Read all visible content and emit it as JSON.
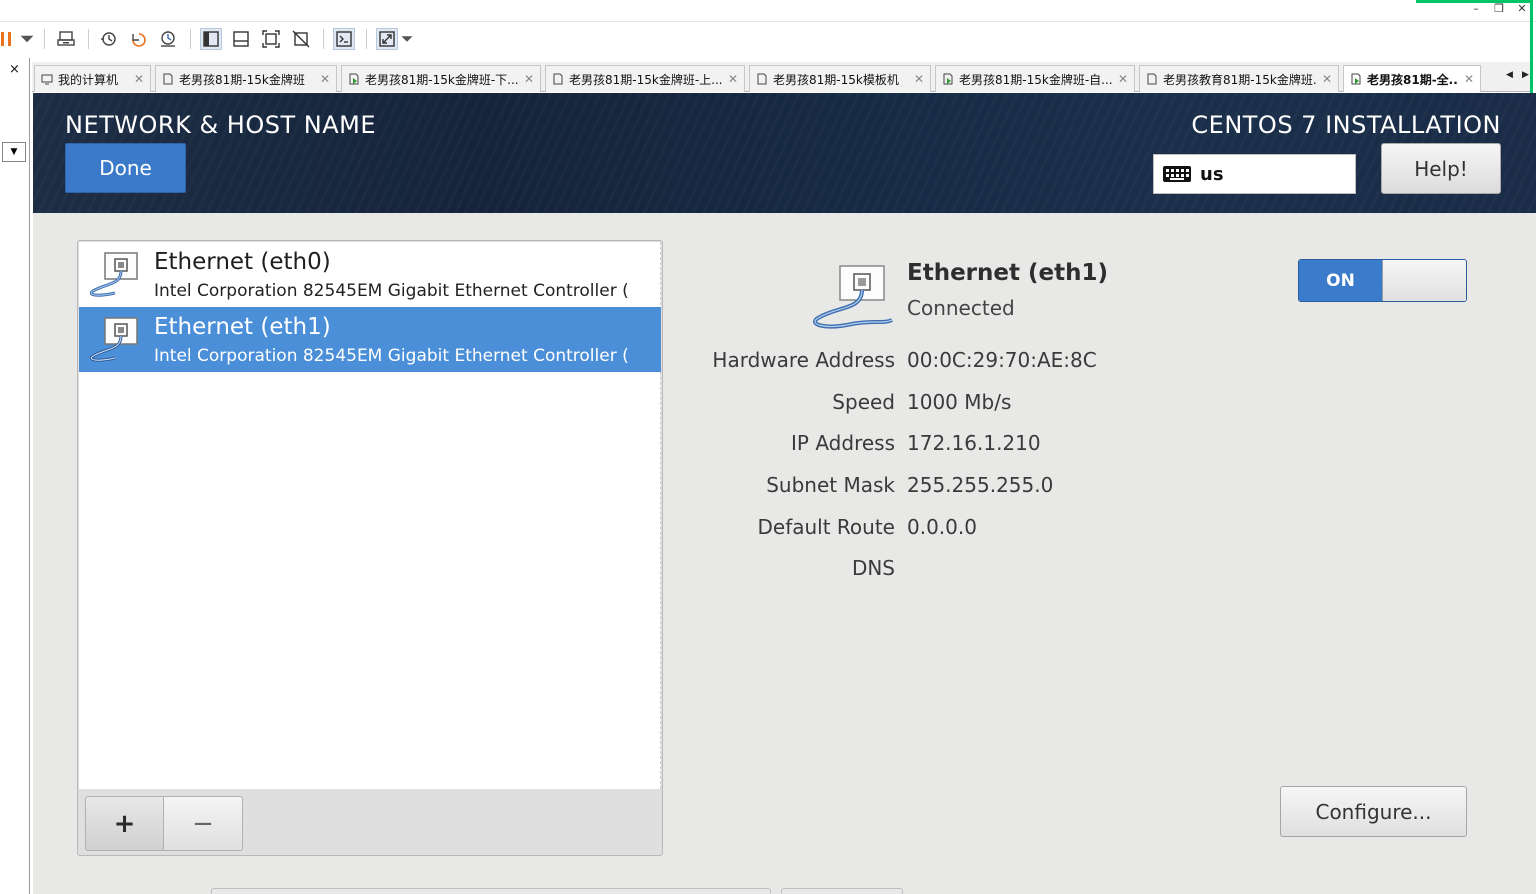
{
  "window": {
    "minimize_glyph": "–",
    "restore_glyph": "❐",
    "close_glyph": "✕"
  },
  "toolbar": {
    "icons": [
      "pause-icon",
      "dropdown-icon",
      "send-ctrl-alt-del-icon",
      "snapshot-icon",
      "revert-snapshot-icon",
      "snapshot-manager-icon",
      "sidebar-view-icon",
      "console-view-icon",
      "fullscreen-icon",
      "unity-icon",
      "terminal-icon",
      "stretch-icon"
    ]
  },
  "sidebar": {
    "close_glyph": "×",
    "dropdown_glyph": "▼"
  },
  "tabs": [
    {
      "label": "我的计算机",
      "icon": "computer-icon",
      "active": false
    },
    {
      "label": "老男孩81期-15k金牌班",
      "icon": "vm-icon",
      "active": false
    },
    {
      "label": "老男孩81期-15k金牌班-下...",
      "icon": "vm-running-icon",
      "active": false
    },
    {
      "label": "老男孩81期-15k金牌班-上...",
      "icon": "vm-icon",
      "active": false
    },
    {
      "label": "老男孩81期-15k模板机",
      "icon": "vm-icon",
      "active": false
    },
    {
      "label": "老男孩81期-15k金牌班-自...",
      "icon": "vm-running-icon",
      "active": false
    },
    {
      "label": "老男孩教育81期-15k金牌班...",
      "icon": "vm-icon",
      "active": false
    },
    {
      "label": "老男孩81期-全...",
      "icon": "vm-running-icon",
      "active": true
    }
  ],
  "header": {
    "title": "NETWORK & HOST NAME",
    "done_label": "Done",
    "product": "CENTOS 7 INSTALLATION",
    "keyboard_layout": "us",
    "help_label": "Help!"
  },
  "devices": [
    {
      "name": "Ethernet (eth0)",
      "description": "Intel Corporation 82545EM Gigabit Ethernet Controller (",
      "selected": false
    },
    {
      "name": "Ethernet (eth1)",
      "description": "Intel Corporation 82545EM Gigabit Ethernet Controller (",
      "selected": true
    }
  ],
  "device_buttons": {
    "add": "+",
    "remove": "−"
  },
  "detail": {
    "name": "Ethernet (eth1)",
    "status": "Connected",
    "toggle_label": "ON",
    "fields": [
      {
        "label": "Hardware Address",
        "value": "00:0C:29:70:AE:8C"
      },
      {
        "label": "Speed",
        "value": "1000 Mb/s"
      },
      {
        "label": "IP Address",
        "value": "172.16.1.210"
      },
      {
        "label": "Subnet Mask",
        "value": "255.255.255.0"
      },
      {
        "label": "Default Route",
        "value": "0.0.0.0"
      },
      {
        "label": "DNS",
        "value": ""
      }
    ],
    "configure_label": "Configure..."
  },
  "colors": {
    "accent": "#3b7ac8",
    "selection": "#4a8fd8",
    "header_bg": "#172a44",
    "body_bg": "#e8e8e7",
    "vmware_green": "#00c46a",
    "pause_orange": "#e8731c"
  }
}
